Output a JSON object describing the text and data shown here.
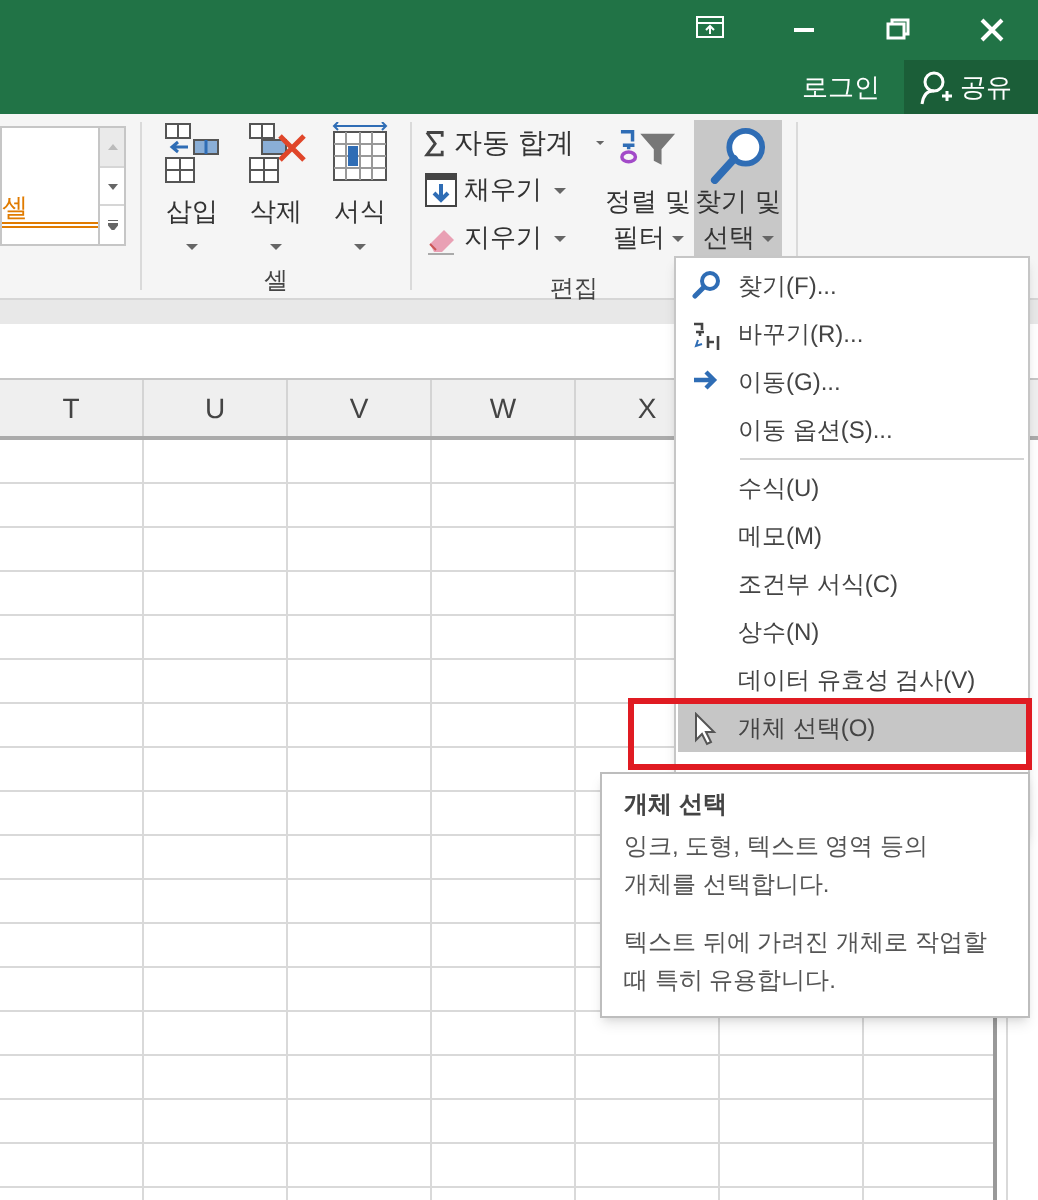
{
  "title_bar": {
    "buttons": [
      {
        "kind": "ribbon-display"
      },
      {
        "kind": "minimize"
      },
      {
        "kind": "restore"
      },
      {
        "kind": "close"
      }
    ],
    "login": "로그인",
    "share": "공유"
  },
  "ribbon": {
    "style_gallery": {
      "text": "셀"
    },
    "cells_group": {
      "label": "셀",
      "buttons": [
        {
          "label": "삽입",
          "kind": "insert"
        },
        {
          "label": "삭제",
          "kind": "delete"
        },
        {
          "label": "서식",
          "kind": "format"
        }
      ]
    },
    "editing_group": {
      "label": "편집",
      "small_buttons": [
        {
          "label": "자동 합계",
          "kind": "autosum"
        },
        {
          "label": "채우기",
          "kind": "fill"
        },
        {
          "label": "지우기",
          "kind": "clear"
        }
      ],
      "large_buttons": [
        {
          "lines": [
            "정렬 및",
            "필터"
          ],
          "kind": "sort",
          "selected": false
        },
        {
          "lines": [
            "찾기 및",
            "선택"
          ],
          "kind": "find",
          "selected": true
        }
      ]
    }
  },
  "columns": [
    "T",
    "U",
    "V",
    "W",
    "X"
  ],
  "menu": {
    "items": [
      {
        "label": "찾기(F)...",
        "kind": "find",
        "separator_before": false,
        "selected": false
      },
      {
        "label": "바꾸기(R)...",
        "kind": "replace",
        "separator_before": false,
        "selected": false
      },
      {
        "label": "이동(G)...",
        "kind": "goto",
        "separator_before": false,
        "selected": false
      },
      {
        "label": "이동 옵션(S)...",
        "kind": "plain",
        "separator_before": false,
        "selected": false
      },
      {
        "label": "수식(U)",
        "kind": "plain",
        "separator_before": true,
        "selected": false
      },
      {
        "label": "메모(M)",
        "kind": "plain",
        "separator_before": false,
        "selected": false
      },
      {
        "label": "조건부 서식(C)",
        "kind": "plain",
        "separator_before": false,
        "selected": false
      },
      {
        "label": "상수(N)",
        "kind": "plain",
        "separator_before": false,
        "selected": false
      },
      {
        "label": "데이터 유효성 검사(V)",
        "kind": "plain",
        "separator_before": false,
        "selected": false
      },
      {
        "label": "개체 선택(O)",
        "kind": "select-objects",
        "separator_before": false,
        "selected": true
      }
    ]
  },
  "tooltip": {
    "title": "개체 선택",
    "paragraphs": [
      [
        "잉크, 도형, 텍스트 영역 등의",
        "개체를 선택합니다."
      ],
      [
        "텍스트 뒤에 가려진 개체로 작업할",
        "때 특히 유용합니다."
      ]
    ]
  }
}
